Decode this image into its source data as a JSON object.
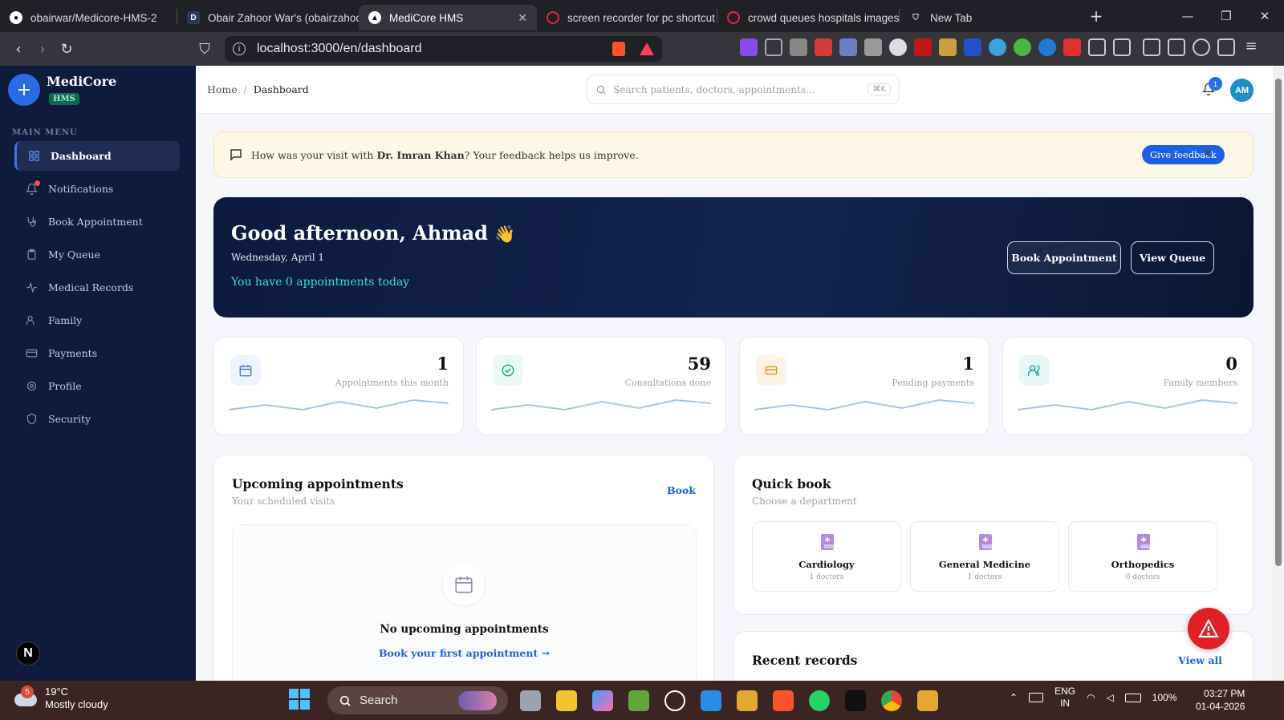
{
  "browser": {
    "tabs": [
      {
        "title": "obairwar/Medicore-HMS-2",
        "icon": "github-icon"
      },
      {
        "title": "Obair Zahoor War's (obairzahoo",
        "icon": "d-icon"
      },
      {
        "title": "MediCore HMS",
        "icon": "app-icon",
        "active": true
      },
      {
        "title": "screen recorder for pc shortcut",
        "icon": "brave-icon"
      },
      {
        "title": "crowd queues hospitals images",
        "icon": "brave-icon"
      },
      {
        "title": "New Tab",
        "icon": "shield-icon"
      }
    ],
    "url": "localhost:3000/en/dashboard"
  },
  "sidebar": {
    "brand": "MediCore",
    "badge": "HMS",
    "menu_heading": "MAIN MENU",
    "items": [
      {
        "label": "Dashboard",
        "icon": "grid-icon",
        "active": true
      },
      {
        "label": "Notifications",
        "icon": "bell-icon"
      },
      {
        "label": "Book Appointment",
        "icon": "stethoscope-icon"
      },
      {
        "label": "My Queue",
        "icon": "clipboard-icon"
      },
      {
        "label": "Medical Records",
        "icon": "activity-icon"
      },
      {
        "label": "Family",
        "icon": "users-icon"
      },
      {
        "label": "Payments",
        "icon": "card-icon"
      },
      {
        "label": "Profile",
        "icon": "gear-icon"
      },
      {
        "label": "Security",
        "icon": "shield-icon"
      }
    ],
    "footer_badge": "N"
  },
  "topbar": {
    "breadcrumb_home": "Home",
    "breadcrumb_sep": "/",
    "breadcrumb_current": "Dashboard",
    "search_placeholder": "Search patients, doctors, appointments…",
    "search_shortcut": "⌘K",
    "notif_count": "1",
    "avatar": "AM"
  },
  "feedback": {
    "text_before": "How was your visit with ",
    "doctor": "Dr. Imran Khan",
    "text_after": "? Your feedback helps us improve.",
    "button": "Give feedback"
  },
  "hero": {
    "greeting": "Good afternoon, Ahmad",
    "emoji": "👋",
    "date": "Wednesday, April 1",
    "summary": "You have 0 appointments today",
    "btn_book": "Book Appointment",
    "btn_queue": "View Queue"
  },
  "stats": [
    {
      "value": "1",
      "label": "Appointments this month",
      "icon": "calendar-icon",
      "color": "#3b6fd8",
      "bg": "#eef3fd"
    },
    {
      "value": "59",
      "label": "Consultations done",
      "icon": "check-circle-icon",
      "color": "#13a36e",
      "bg": "#e9f8f1"
    },
    {
      "value": "1",
      "label": "Pending payments",
      "icon": "card-icon",
      "color": "#e58a18",
      "bg": "#fdf3e4"
    },
    {
      "value": "0",
      "label": "Family members",
      "icon": "users-icon",
      "color": "#1a9fa0",
      "bg": "#e7f6f6"
    }
  ],
  "upcoming": {
    "title": "Upcoming appointments",
    "subtitle": "Your scheduled visits",
    "link": "Book",
    "empty_title": "No upcoming appointments",
    "empty_link": "Book your first appointment →"
  },
  "quickbook": {
    "title": "Quick book",
    "subtitle": "Choose a department",
    "departments": [
      {
        "name": "Cardiology",
        "count": "1 doctors"
      },
      {
        "name": "General Medicine",
        "count": "1 doctors"
      },
      {
        "name": "Orthopedics",
        "count": "0 doctors"
      }
    ]
  },
  "records": {
    "title": "Recent records",
    "link": "View all"
  },
  "taskbar": {
    "temp": "19°C",
    "weather": "Mostly cloudy",
    "weather_badge": "5",
    "search": "Search",
    "lang1": "ENG",
    "lang2": "IN",
    "battery": "100%",
    "time": "03:27 PM",
    "date": "01-04-2026"
  }
}
